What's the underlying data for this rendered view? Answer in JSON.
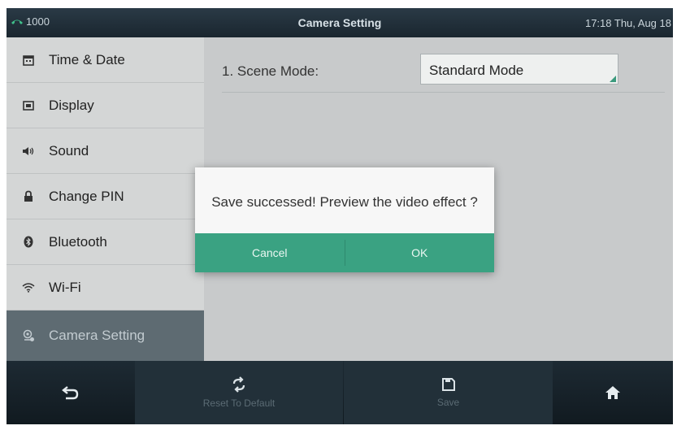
{
  "status_bar": {
    "line_number": "1000",
    "title": "Camera Setting",
    "datetime": "17:18 Thu, Aug 18"
  },
  "sidebar": {
    "items": [
      {
        "label": "Time & Date",
        "icon": "calendar-icon"
      },
      {
        "label": "Display",
        "icon": "display-icon"
      },
      {
        "label": "Sound",
        "icon": "speaker-icon"
      },
      {
        "label": "Change PIN",
        "icon": "lock-icon"
      },
      {
        "label": "Bluetooth",
        "icon": "bluetooth-icon"
      },
      {
        "label": "Wi-Fi",
        "icon": "wifi-icon"
      },
      {
        "label": "Camera Setting",
        "icon": "camera-setting-icon",
        "active": true
      }
    ]
  },
  "main": {
    "scene_mode_label": "1. Scene Mode:",
    "scene_mode_value": "Standard Mode"
  },
  "dialog": {
    "message": "Save successed! Preview the video effect ?",
    "cancel_label": "Cancel",
    "ok_label": "OK"
  },
  "softkeys": {
    "back_icon": "back-arrow-icon",
    "reset_label": "Reset To Default",
    "reset_icon": "refresh-icon",
    "save_label": "Save",
    "save_icon": "floppy-disk-icon",
    "home_icon": "home-icon"
  },
  "colors": {
    "accent_green": "#3aa282",
    "active_sidebar": "#5e6b72",
    "status_bar": "#1f2d37"
  }
}
